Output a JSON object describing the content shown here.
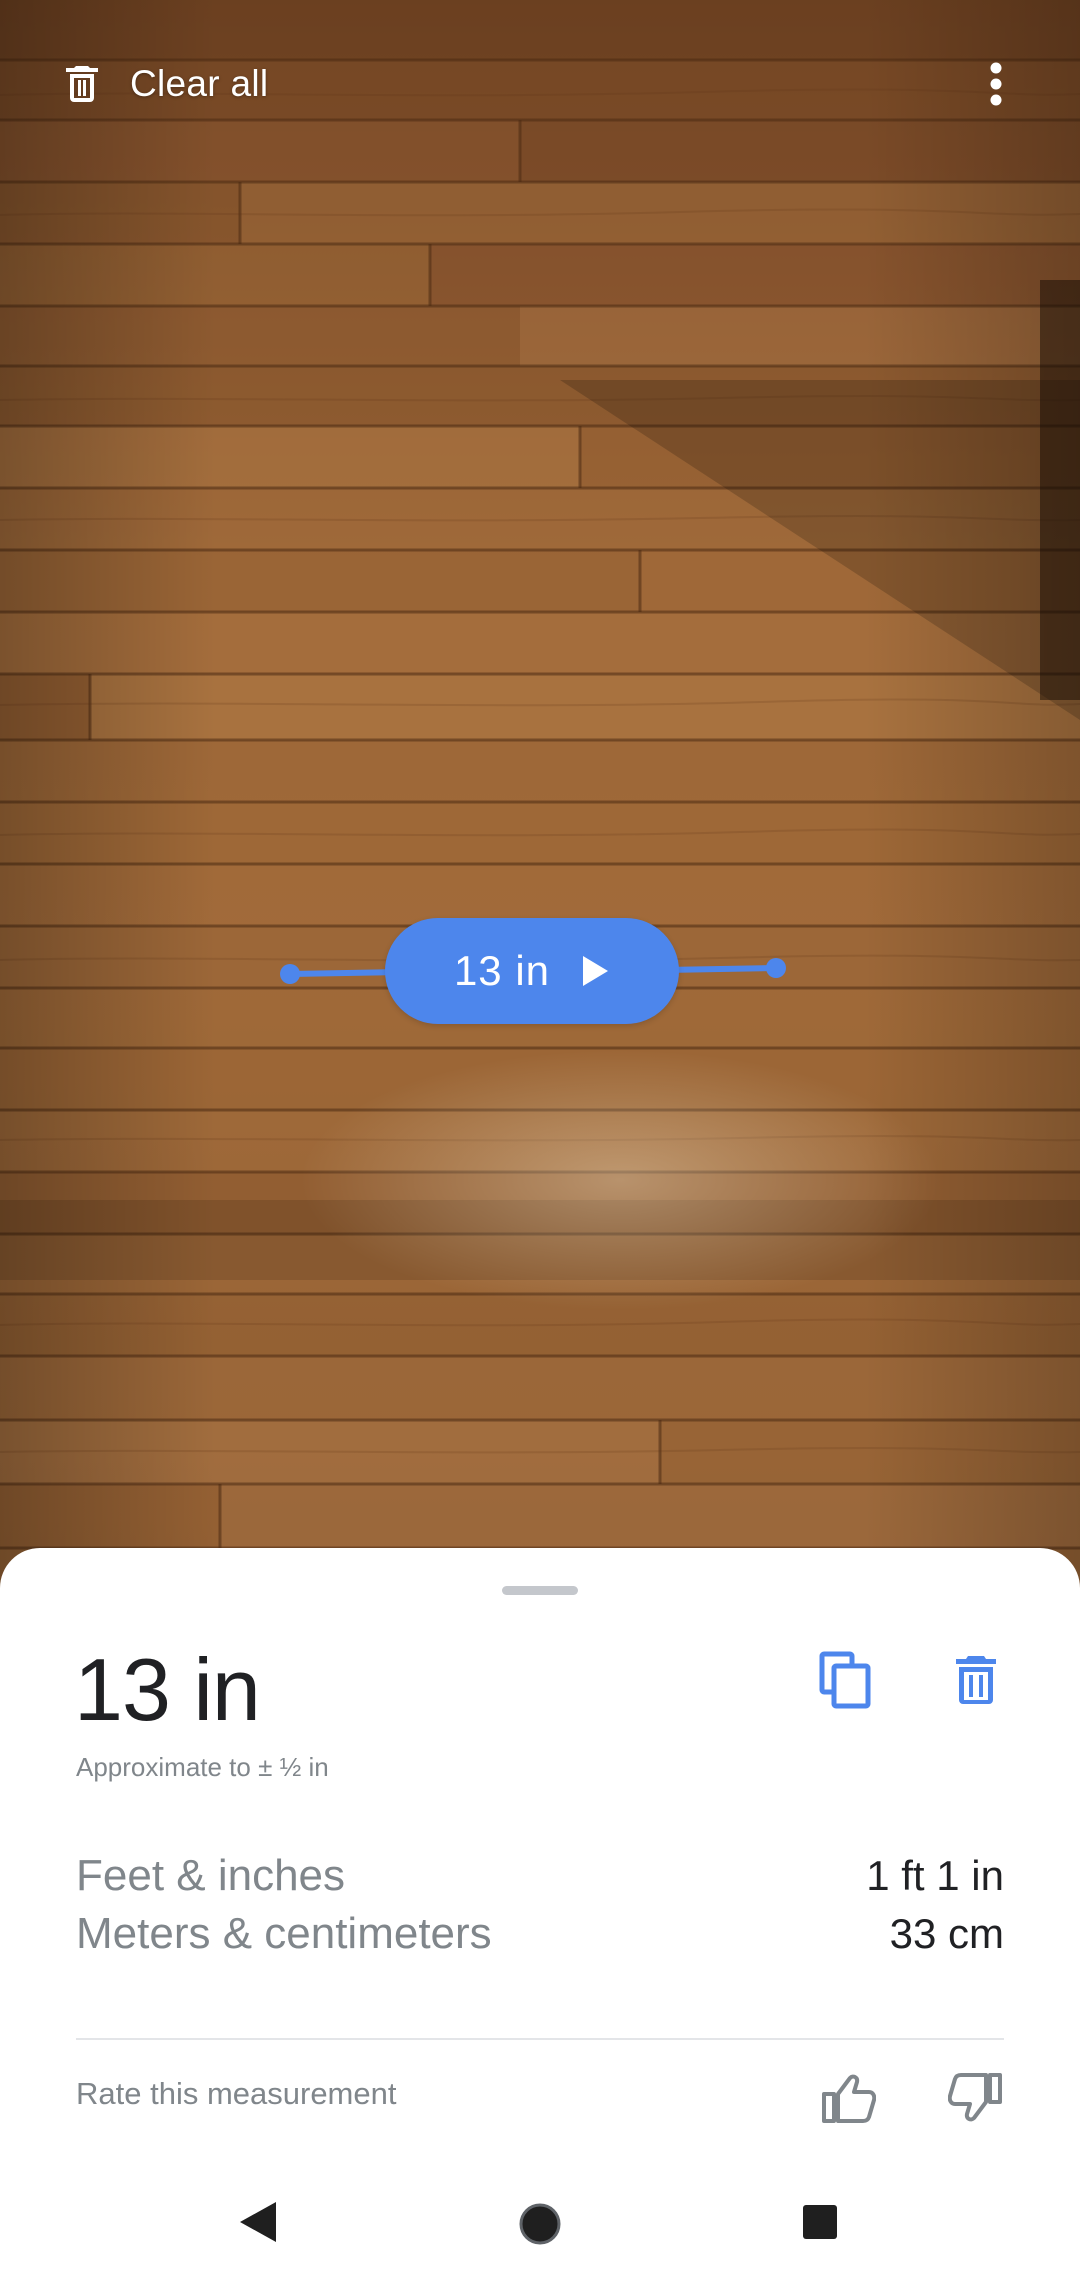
{
  "top_bar": {
    "clear_all_label": "Clear all",
    "clear_all_icon": "trash-icon",
    "more_icon": "more-vert-icon"
  },
  "measurement": {
    "pill_label": "13 in",
    "play_icon": "play-arrow-icon",
    "line_color": "#4d86ec"
  },
  "sheet": {
    "value": "13 in",
    "approximation": "Approximate to ± ½ in",
    "conversions": [
      {
        "label": "Feet & inches",
        "value": "1 ft 1 in"
      },
      {
        "label": "Meters & centimeters",
        "value": "33 cm"
      }
    ],
    "copy_icon": "copy-icon",
    "delete_icon": "trash-icon",
    "rate_label": "Rate this measurement",
    "thumb_up_icon": "thumb-up-icon",
    "thumb_down_icon": "thumb-down-icon"
  },
  "nav": {
    "back_icon": "back-triangle-icon",
    "home_icon": "home-circle-icon",
    "recents_icon": "recents-square-icon"
  },
  "colors": {
    "accent": "#4d86ec",
    "primary_text": "#202124",
    "secondary_text": "#80868b"
  }
}
